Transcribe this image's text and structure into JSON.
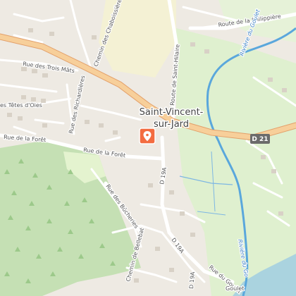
{
  "map": {
    "town": {
      "line1": "Saint-Vincent-",
      "line2": "sur-Jard"
    },
    "road_shield": "D 21",
    "streets": {
      "trois_mats": "Rue des Trois Mâts",
      "chaboissieres": "Chemin des Chaboissières",
      "route_philippiere": "Route de la Philippière",
      "tetes_oies": "es Têtes d'Oies",
      "richardieres": "Rue des Richardières",
      "st_hilaire": "Route de Saint-Hilaire",
      "foret1": "Rue de la Forêt",
      "foret2": "Rue de la Forêt",
      "d19a_1": "D 19A",
      "d19a_2": "D 19A",
      "d19a_3": "D 19A",
      "bucheries": "Rue des Bûcheries",
      "bellebat": "Chemin de Bellebat",
      "goulet": "Rue du Goulet",
      "goulet_bottom": "Goulet"
    },
    "rivers": {
      "goulet_north": "Rivière du Goulet",
      "goulet_south": "Rivière du Go"
    },
    "colors": {
      "background": "#eeeae3",
      "forest": "#c5e0b4",
      "park": "#dff0cf",
      "water": "#aad3df",
      "river": "#5aa7dc",
      "main_road": "#f7cf9a",
      "minor_road": "#ffffff",
      "marker": "#f36c40"
    },
    "marker": "map-pin-icon"
  }
}
